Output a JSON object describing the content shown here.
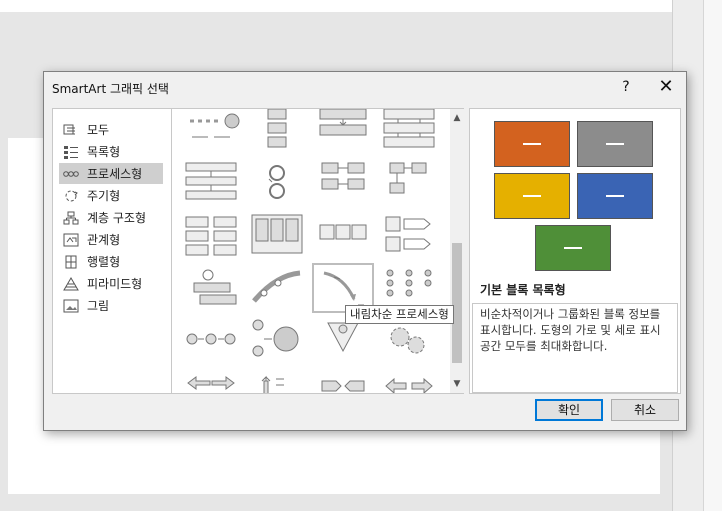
{
  "dialog": {
    "title": "SmartArt 그래픽 선택",
    "help_label": "?",
    "close_label": "✕"
  },
  "categories": [
    {
      "label": "모두",
      "icon": "all-icon",
      "selected": false
    },
    {
      "label": "목록형",
      "icon": "list-icon",
      "selected": false
    },
    {
      "label": "프로세스형",
      "icon": "process-icon",
      "selected": true
    },
    {
      "label": "주기형",
      "icon": "cycle-icon",
      "selected": false
    },
    {
      "label": "계층 구조형",
      "icon": "hierarchy-icon",
      "selected": false
    },
    {
      "label": "관계형",
      "icon": "relationship-icon",
      "selected": false
    },
    {
      "label": "행렬형",
      "icon": "matrix-icon",
      "selected": false
    },
    {
      "label": "피라미드형",
      "icon": "pyramid-icon",
      "selected": false
    },
    {
      "label": "그림",
      "icon": "picture-icon",
      "selected": false
    }
  ],
  "gallery": {
    "selected_index": 14,
    "tooltip": "내림차순 프로세스형"
  },
  "preview": {
    "title": "기본 블록 목록형",
    "description": "비순차적이거나 그룹화된 블록 정보를 표시합니다. 도형의 가로 및 세로 표시 공간 모두를 최대화합니다.",
    "colors": [
      "#d3621f",
      "#8c8c8c",
      "#e5b000",
      "#3a64b4",
      "#4f8f38"
    ]
  },
  "buttons": {
    "ok": "확인",
    "cancel": "취소"
  }
}
